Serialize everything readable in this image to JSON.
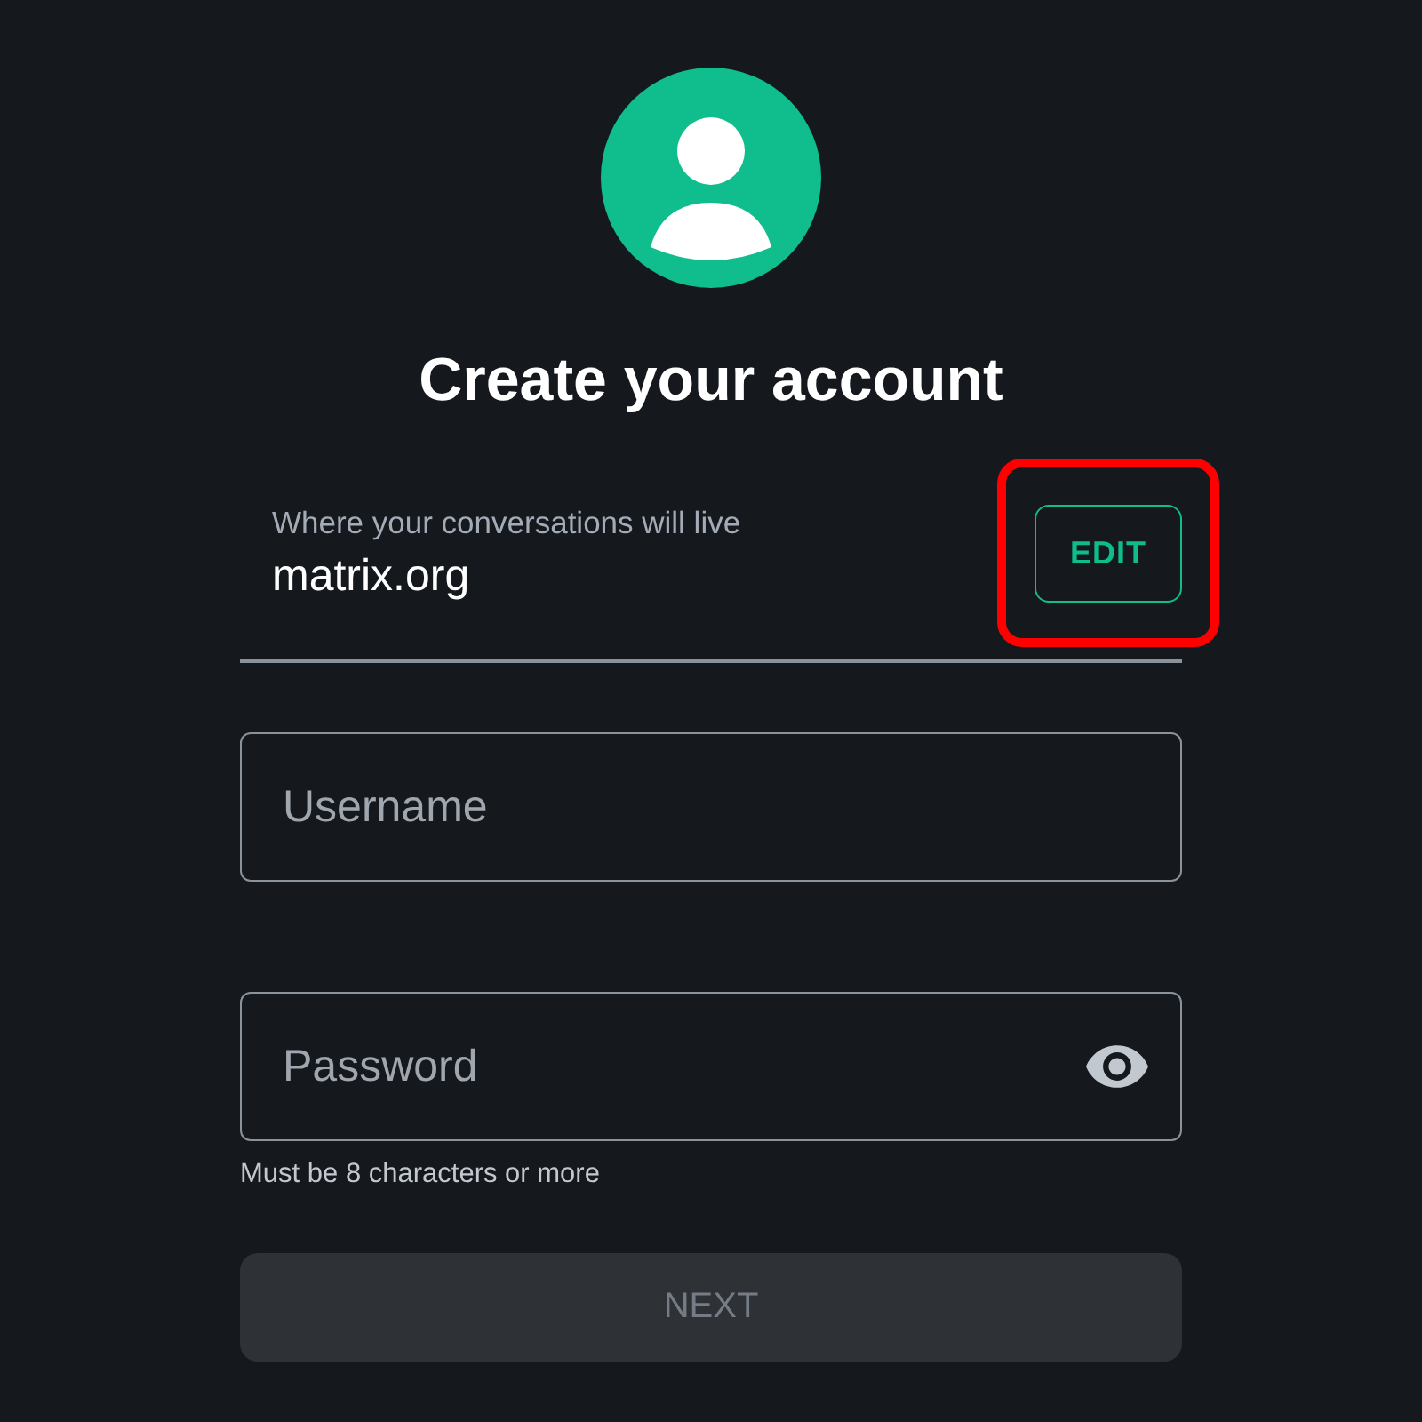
{
  "title": "Create your account",
  "server": {
    "label": "Where your conversations will live",
    "value": "matrix.org"
  },
  "edit_button": {
    "label": "EDIT",
    "highlighted": true
  },
  "fields": [
    {
      "kind": "text",
      "placeholder": "Username"
    },
    {
      "kind": "password",
      "placeholder": "Password",
      "helper": "Must be 8 characters or more"
    }
  ],
  "next_button": {
    "label": "NEXT",
    "disabled": true
  }
}
